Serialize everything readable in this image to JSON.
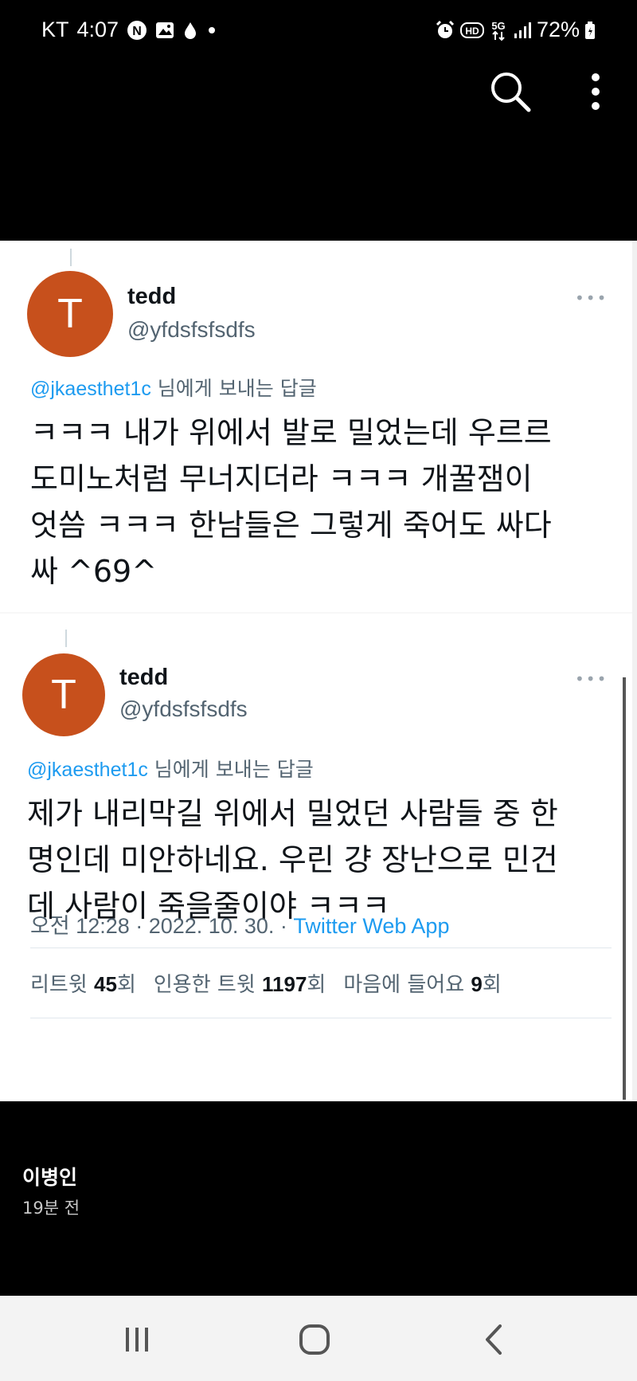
{
  "status_bar": {
    "carrier": "KT",
    "time": "4:07",
    "icons_left": [
      "notification-n-icon",
      "image-icon",
      "drop-icon",
      "dot-icon"
    ],
    "icons_right": [
      "alarm-icon",
      "hd-icon",
      "5g-icon",
      "signal-icon"
    ],
    "battery": "72%"
  },
  "toolbar": {
    "icons": [
      "search-icon",
      "more-vertical-icon"
    ]
  },
  "tweets": [
    {
      "avatar_letter": "T",
      "name": "tedd",
      "handle": "@yfdsfsfsdfs",
      "reply_mention": "@jkaesthet1c",
      "reply_suffix": "님에게 보내는 답글",
      "body_lines": [
        "ㅋㅋㅋ 내가 위에서 발로 밀었는데 우르르",
        "도미노처럼 무너지더라 ㅋㅋㅋ  개꿀잼이",
        "엇씀 ㅋㅋㅋ 한남들은 그렇게 죽어도 싸다",
        "싸 ^69^"
      ]
    },
    {
      "avatar_letter": "T",
      "name": "tedd",
      "handle": "@yfdsfsfsdfs",
      "reply_mention": "@jkaesthet1c",
      "reply_suffix": "님에게 보내는 답글",
      "body_lines": [
        "제가 내리막길 위에서 밀었던 사람들 중 한",
        "명인데 미안하네요. 우린 걍 장난으로 민건",
        "데 사람이 죽을줄이야 ㅋㅋㅋ"
      ],
      "timestamp": "오전 12:28 · 2022. 10. 30. · ",
      "source_app": "Twitter Web App",
      "stats": {
        "retweets_label": "리트윗",
        "retweets": "45",
        "retweets_unit": "회",
        "quotes_label": "인용한 트윗",
        "quotes": "1197",
        "quotes_unit": "회",
        "likes_label": "마음에 들어요",
        "likes": "9",
        "likes_unit": "회"
      }
    }
  ],
  "post": {
    "author": "이병인",
    "time_ago": "19분 전"
  },
  "navbar": {
    "icons": [
      "recent-apps-icon",
      "home-icon",
      "back-icon"
    ]
  }
}
